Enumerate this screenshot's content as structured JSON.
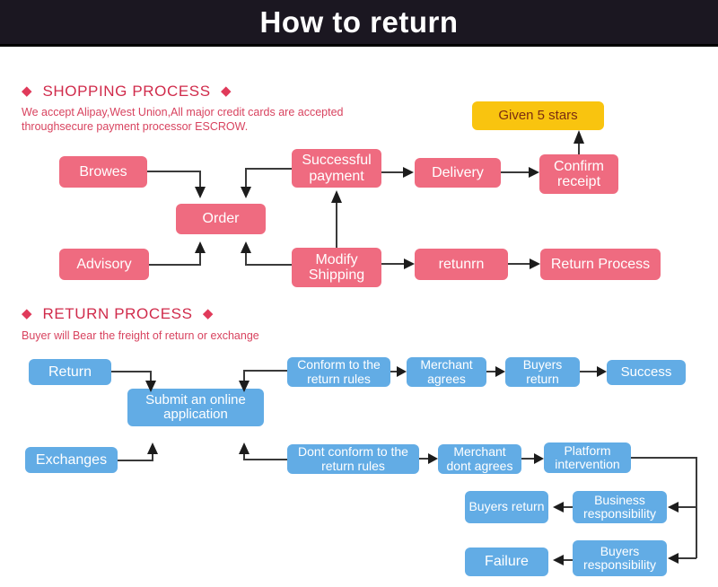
{
  "header": {
    "title": "How to return"
  },
  "sections": [
    {
      "id": "shopping",
      "heading": "SHOPPING PROCESS",
      "diamond_left": "◆",
      "diamond_right": "◆",
      "subtitle": "We accept Alipay,West Union,All major credit cards are accepted\nthroughsecure payment processor ESCROW."
    },
    {
      "id": "return",
      "heading": "RETURN PROCESS",
      "diamond_left": "◆",
      "diamond_right": "◆",
      "subtitle": "Buyer will Bear the freight of return or exchange"
    }
  ],
  "shopping_nodes": {
    "browes": "Browes",
    "order": "Order",
    "successful_payment": "Successful payment",
    "delivery": "Delivery",
    "confirm_receipt": "Confirm receipt",
    "given_5_stars": "Given 5 stars",
    "advisory": "Advisory",
    "modify_shipping": "Modify Shipping",
    "retunrn": "retunrn",
    "return_process": "Return Process"
  },
  "return_nodes": {
    "return": "Return",
    "submit_application": "Submit an online application",
    "conform_rules": "Conform to the return rules",
    "merchant_agrees": "Merchant agrees",
    "buyers_return_top": "Buyers return",
    "success": "Success",
    "exchanges": "Exchanges",
    "dont_conform_rules": "Dont conform to the return rules",
    "merchant_dont_agrees": "Merchant dont agrees",
    "platform_intervention": "Platform intervention",
    "business_responsibility": "Business responsibility",
    "buyers_return_mid": "Buyers return",
    "buyers_responsibility": "Buyers responsibility",
    "failure": "Failure"
  },
  "colors": {
    "banner_bg": "#1b1721",
    "banner_text": "#ffffff",
    "pink": "#ef6b80",
    "blue": "#62ace5",
    "gold": "#f9c40f",
    "gold_text": "#7b2d12",
    "heading": "#d02b4b",
    "subtitle": "#d8435f",
    "connector": "#3a3a3a"
  }
}
